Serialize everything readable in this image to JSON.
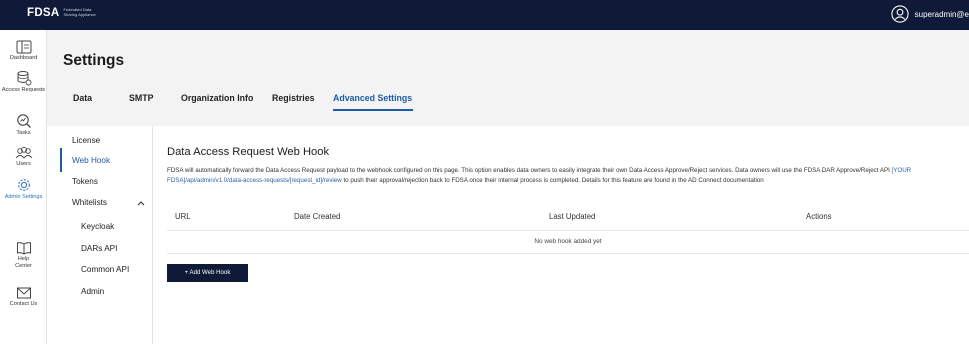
{
  "topbar": {
    "logo_text": "FDSA",
    "logo_subtext": "Federated Data Sharing Appliance",
    "user_name": "superadmin@e",
    "user_icon": "user-circle-icon"
  },
  "leftnav": {
    "items": [
      {
        "label": "Dashboard",
        "icon": "dashboard-icon"
      },
      {
        "label": "Access Requests",
        "icon": "database-access-icon"
      },
      {
        "label": "Tasks",
        "icon": "tasks-magnifier-icon"
      },
      {
        "label": "Users",
        "icon": "users-icon"
      },
      {
        "label": "Admin Settings",
        "icon": "gear-icon",
        "active": true
      },
      {
        "label": "Help Center",
        "icon": "book-icon"
      },
      {
        "label": "Contact Us",
        "icon": "mail-icon"
      }
    ]
  },
  "header": {
    "title": "Settings",
    "tabs": [
      {
        "label": "Data"
      },
      {
        "label": "SMTP"
      },
      {
        "label": "Organization Info"
      },
      {
        "label": "Registries"
      },
      {
        "label": "Advanced Settings",
        "active": true
      }
    ]
  },
  "subnav": {
    "items": [
      {
        "label": "License"
      },
      {
        "label": "Web Hook",
        "active": true
      },
      {
        "label": "Tokens"
      },
      {
        "label": "Whitelists",
        "expandable": true
      },
      {
        "label": "Keycloak"
      },
      {
        "label": "DARs API"
      },
      {
        "label": "Common API"
      },
      {
        "label": "Admin"
      }
    ]
  },
  "main": {
    "section_title": "Data Access Request Web Hook",
    "description_part1": "FDSA will automatically forward the Data Access Request payload to the webhook configured on this page. This option enables data owners to easily integrate their own Data Access Approve/Reject services. Data owners will use the FDSA DAR Approve/Reject API ",
    "description_link": "[YOUR FDSA]/api/admin/v1.0/data-access-requests/[request_id]/review",
    "description_part2": " to push their approval/rejection back to FDSA once their internal process is completed. Details for this feature are found in the AD Connect documentation",
    "table": {
      "columns": [
        "URL",
        "Date Created",
        "Last Updated",
        "Actions"
      ],
      "empty_text": "No web hook added yet"
    },
    "add_button_label": "+ Add Web Hook"
  },
  "colors": {
    "topbar_bg": "#0e1a37",
    "accent": "#1d5ca8",
    "header_bg": "#f3f3f3"
  }
}
